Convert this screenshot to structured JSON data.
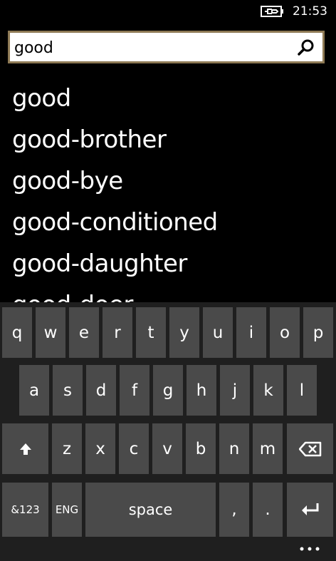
{
  "status_bar": {
    "time": "21:53",
    "battery_icon": "battery-charging-icon"
  },
  "search": {
    "value": "good",
    "placeholder": "",
    "button_icon": "search-icon"
  },
  "suggestions": [
    "good",
    "good-brother",
    "good-bye",
    "good-conditioned",
    "good-daughter",
    "good-doer"
  ],
  "keyboard": {
    "row1": [
      "q",
      "w",
      "e",
      "r",
      "t",
      "y",
      "u",
      "i",
      "o",
      "p"
    ],
    "row2": [
      "a",
      "s",
      "d",
      "f",
      "g",
      "h",
      "j",
      "k",
      "l"
    ],
    "row3": [
      "z",
      "x",
      "c",
      "v",
      "b",
      "n",
      "m"
    ],
    "shift_icon": "shift-arrow-icon",
    "backspace_icon": "backspace-icon",
    "symbols_label": "&123",
    "language_label": "ENG",
    "space_label": "space",
    "comma_label": ",",
    "period_label": ".",
    "enter_icon": "enter-icon",
    "more_icon": "ellipsis-icon"
  },
  "colors": {
    "background": "#000000",
    "key": "#4a4a4a",
    "keyboard_bg": "#1f1f1f",
    "search_border": "#8e7a55"
  }
}
